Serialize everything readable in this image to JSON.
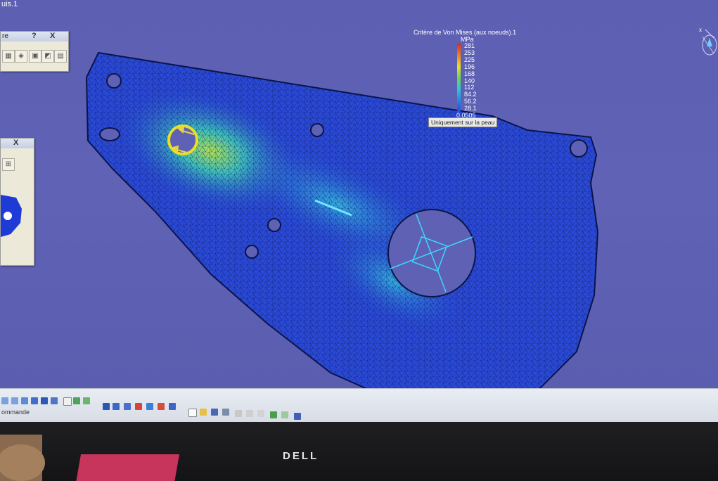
{
  "window": {
    "title_fragment": "uis.1"
  },
  "legend": {
    "title": "Critère de Von Mises (aux noeuds).1",
    "unit": "MPa",
    "values": [
      "281",
      "253",
      "225",
      "196",
      "168",
      "140",
      "112",
      "84.2",
      "56.2",
      "28.1",
      "0.0505"
    ],
    "note": "Uniquement sur la peau",
    "colors": {
      "max": "#d92b1f",
      "high": "#f08a1e",
      "mid": "#e8e023",
      "low_mid": "#6fd64a",
      "low": "#2ac7d6",
      "min": "#1e3cd8"
    }
  },
  "left_panel_1": {
    "header_fragment": "re",
    "help_label": "?",
    "close_label": "X"
  },
  "left_panel_2": {
    "close_label": "X"
  },
  "bottom_toolbar": {
    "command_label": "ommande"
  },
  "monitor": {
    "brand": "DELL"
  },
  "colors": {
    "background": "#5f61b4",
    "part_base": "#2a49d6",
    "stress_hotspot": "#e8e023",
    "mesh": "#0b1a55"
  }
}
